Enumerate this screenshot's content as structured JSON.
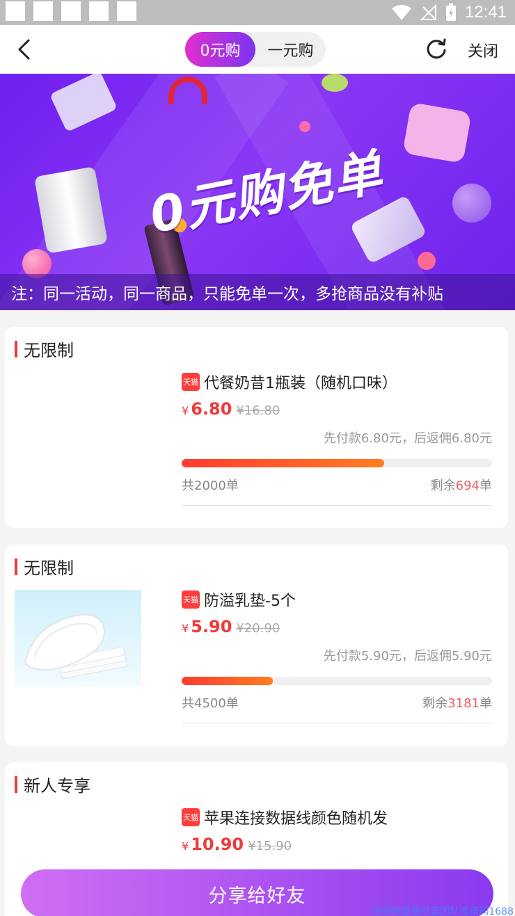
{
  "status_bar": {
    "time": "12:41"
  },
  "nav": {
    "tabs": [
      {
        "label": "0元购",
        "active": true
      },
      {
        "label": "一元购",
        "active": false
      }
    ],
    "close_label": "关闭"
  },
  "banner": {
    "title": "0元购免单",
    "note": "注：同一活动，同一商品，只能免单一次，多抢商品没有补贴"
  },
  "products": [
    {
      "category": "无限制",
      "badge": "天猫",
      "title": "代餐奶昔1瓶装（随机口味）",
      "currency": "¥",
      "price": "6.80",
      "original_price": "¥16.80",
      "payment_note": "先付款6.80元，后返佣6.80元",
      "progress": 0.653,
      "total": "共2000单",
      "remain_prefix": "剩余",
      "remain_count": "694",
      "remain_suffix": "单",
      "has_image": false
    },
    {
      "category": "无限制",
      "badge": "天猫",
      "title": "防溢乳垫-5个",
      "currency": "¥",
      "price": "5.90",
      "original_price": "¥20.90",
      "payment_note": "先付款5.90元，后返佣5.90元",
      "progress": 0.293,
      "total": "共4500单",
      "remain_prefix": "剩余",
      "remain_count": "3181",
      "remain_suffix": "单",
      "has_image": true
    },
    {
      "category": "新人专享",
      "badge": "天猫",
      "title": "苹果连接数据线颜色随机发",
      "currency": "¥",
      "price": "10.90",
      "original_price": "¥15.90",
      "has_image": false
    }
  ],
  "share_label": "分享给好友",
  "watermark": "高佣联盟最财富团队邀请码1688",
  "colors": {
    "accent_red": "#f03a3a",
    "brand_purple": "#7c35f0",
    "brand_pink": "#e02fcf"
  }
}
